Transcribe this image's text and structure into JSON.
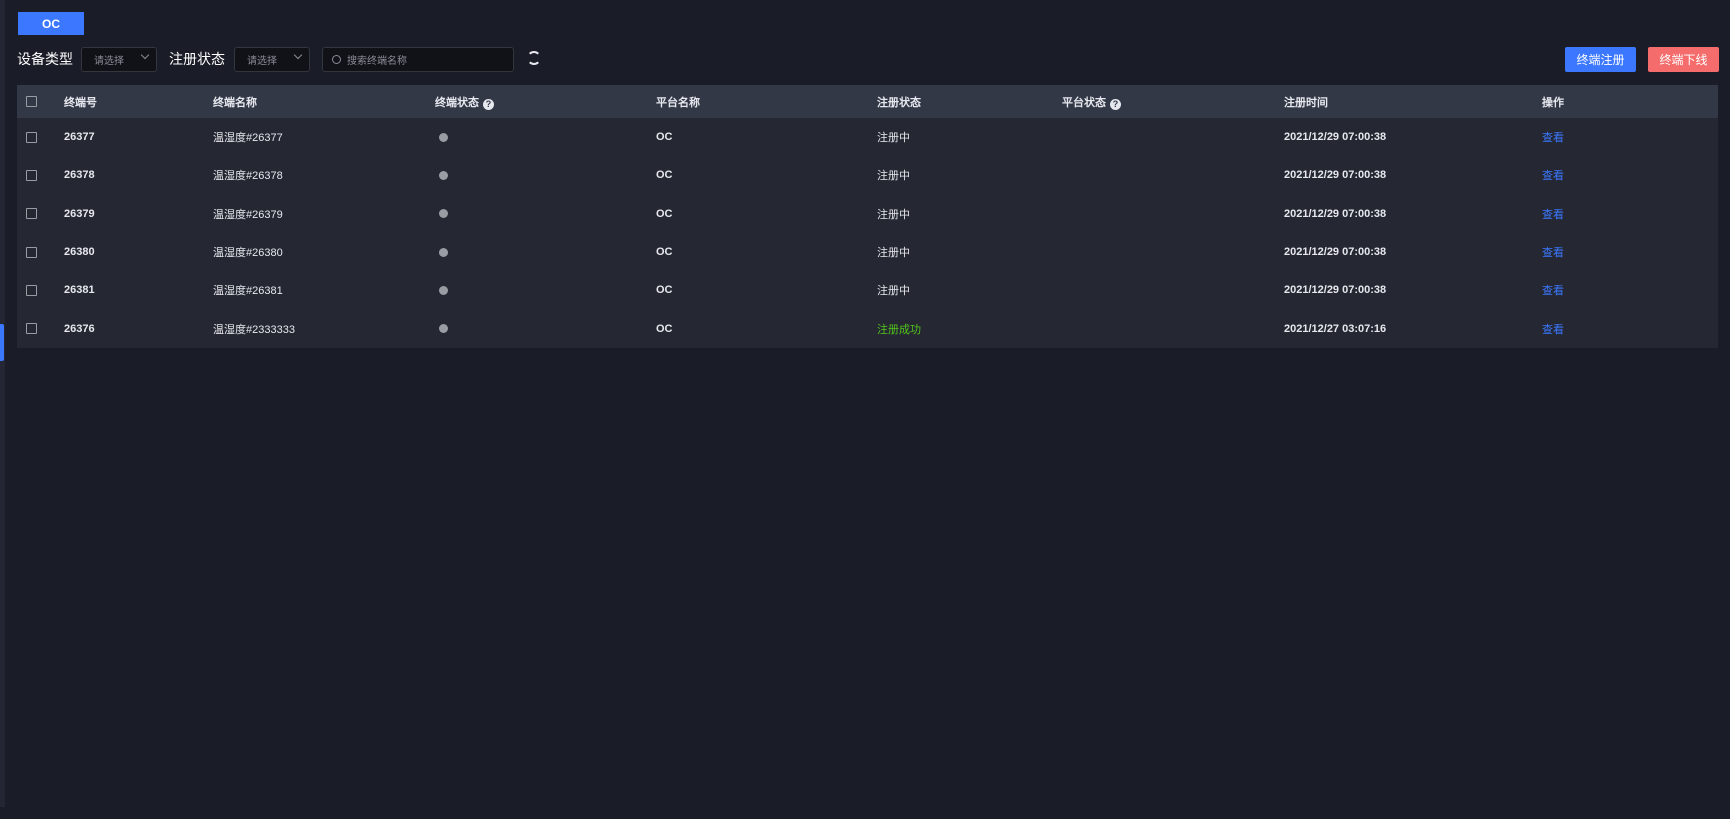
{
  "tab": "OC",
  "filters": {
    "device_type_label": "设备类型",
    "device_type_placeholder": "请选择",
    "reg_status_label": "注册状态",
    "reg_status_placeholder": "请选择",
    "search_placeholder": "搜索终端名称"
  },
  "actions": {
    "register": "终端注册",
    "offline": "终端下线"
  },
  "colors": {
    "primary": "#3b78ff",
    "danger": "#f56c6c",
    "success": "#52c41a"
  },
  "table": {
    "headers": [
      "终端号",
      "终端名称",
      "终端状态",
      "平台名称",
      "注册状态",
      "平台状态",
      "注册时间",
      "操作"
    ],
    "rows": [
      {
        "id": "26377",
        "name": "温湿度#26377",
        "platform": "OC",
        "reg_status": "注册中",
        "time": "2021/12/29 07:00:38",
        "action": "查看"
      },
      {
        "id": "26378",
        "name": "温湿度#26378",
        "platform": "OC",
        "reg_status": "注册中",
        "time": "2021/12/29 07:00:38",
        "action": "查看"
      },
      {
        "id": "26379",
        "name": "温湿度#26379",
        "platform": "OC",
        "reg_status": "注册中",
        "time": "2021/12/29 07:00:38",
        "action": "查看"
      },
      {
        "id": "26380",
        "name": "温湿度#26380",
        "platform": "OC",
        "reg_status": "注册中",
        "time": "2021/12/29 07:00:38",
        "action": "查看"
      },
      {
        "id": "26381",
        "name": "温湿度#26381",
        "platform": "OC",
        "reg_status": "注册中",
        "time": "2021/12/29 07:00:38",
        "action": "查看"
      },
      {
        "id": "26376",
        "name": "温湿度#2333333",
        "platform": "OC",
        "reg_status": "注册成功",
        "time": "2021/12/27 03:07:16",
        "action": "查看"
      }
    ]
  }
}
